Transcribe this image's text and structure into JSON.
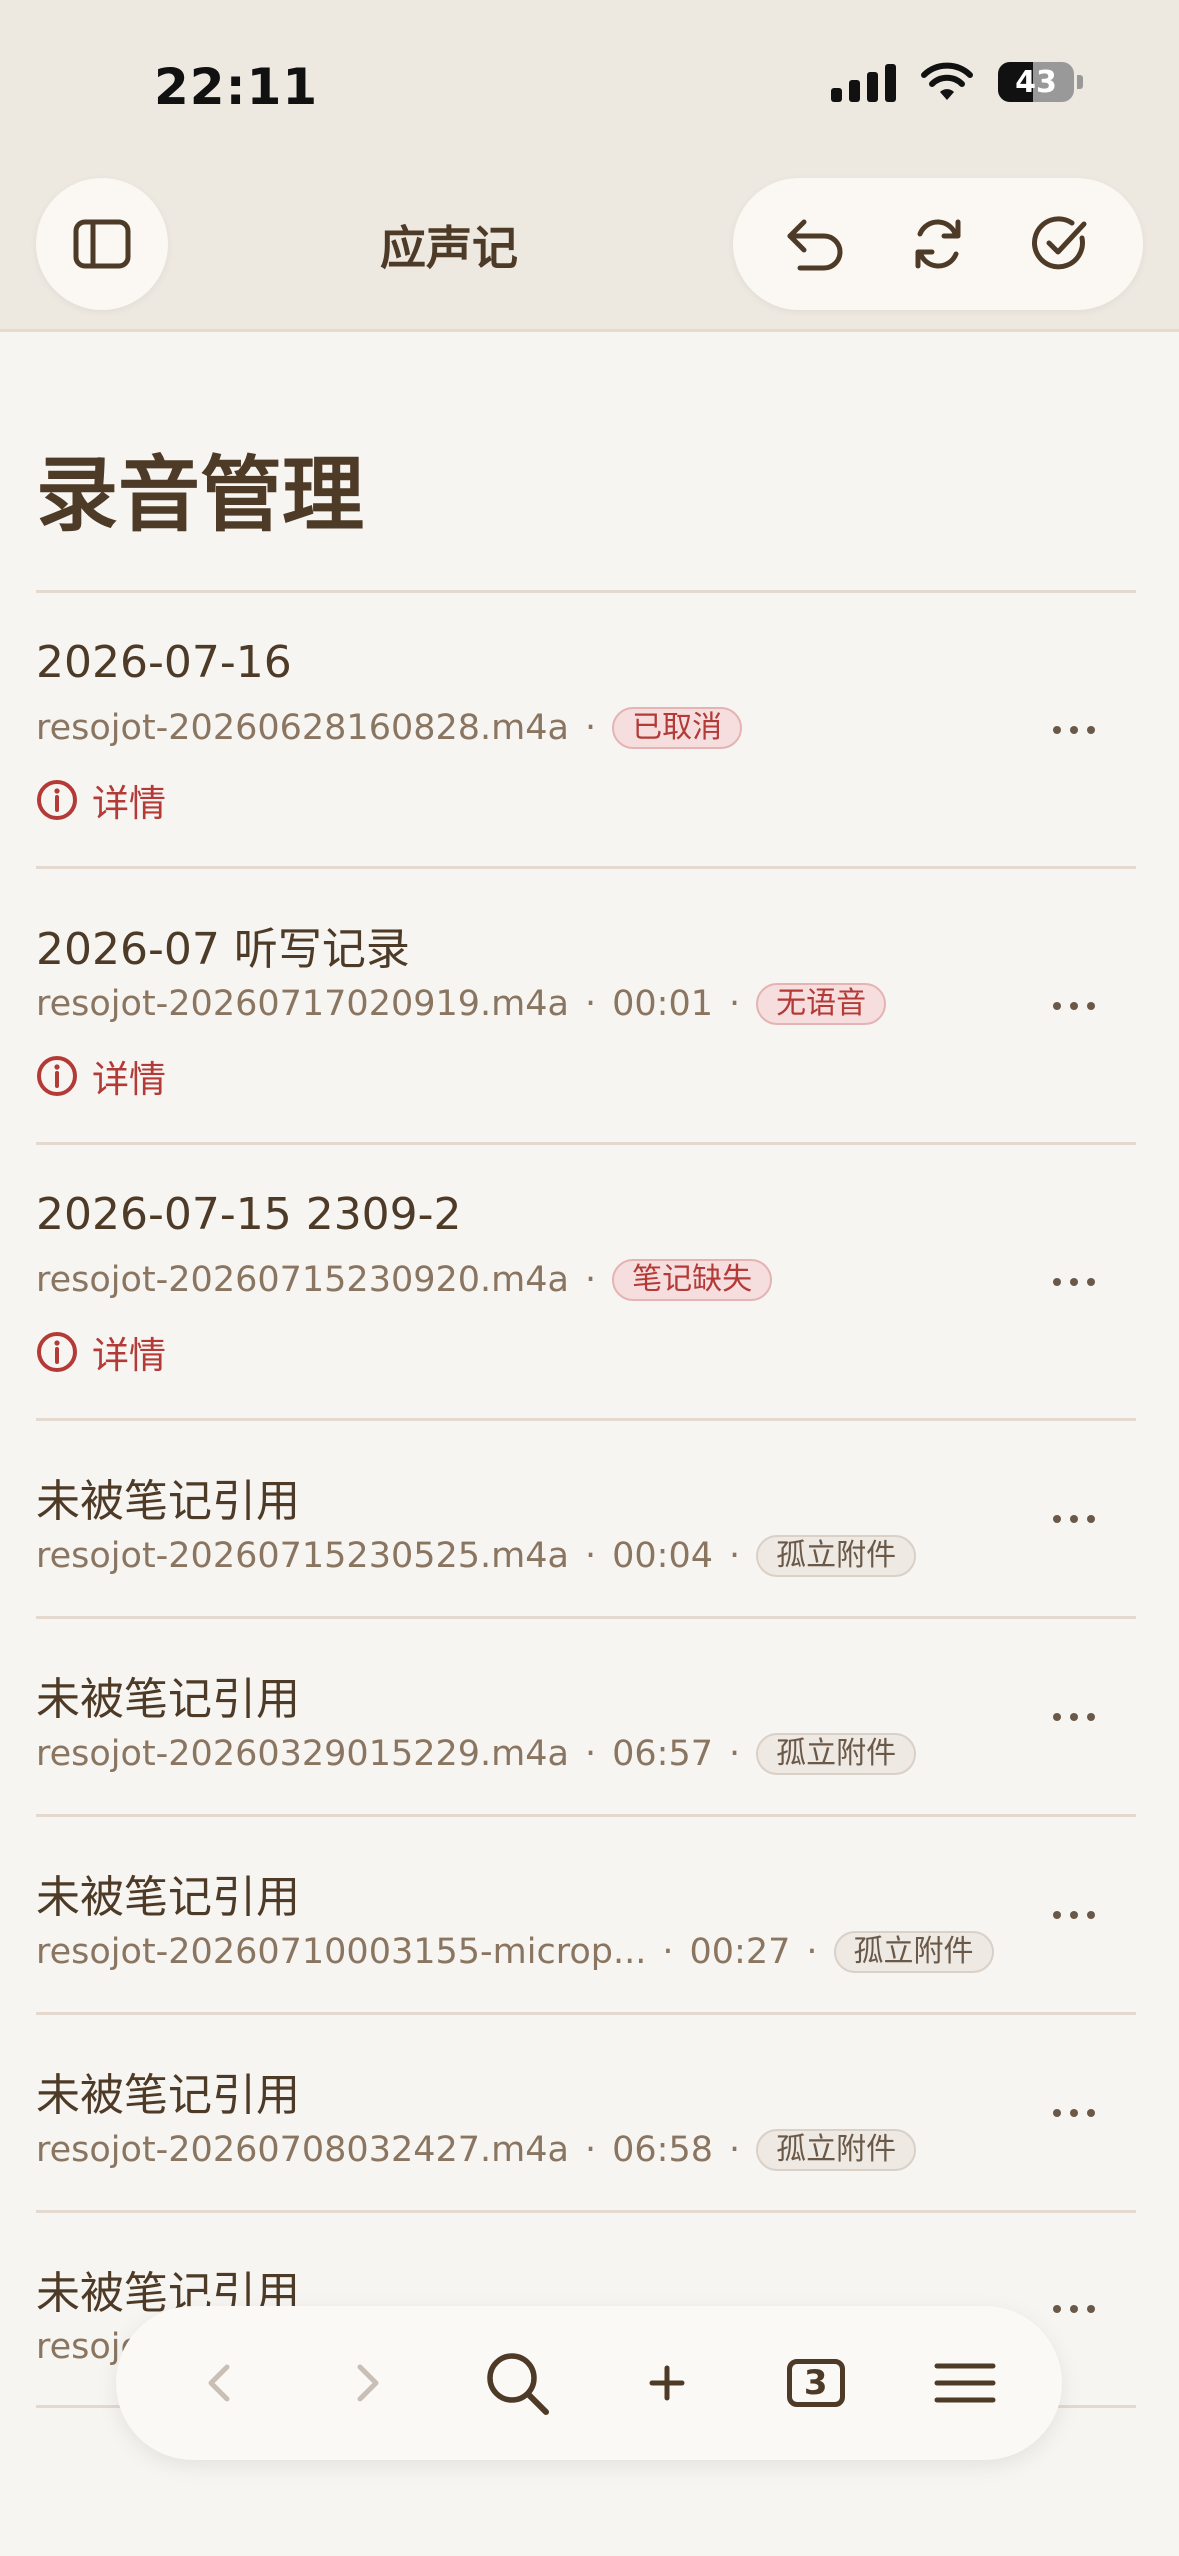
{
  "status_bar": {
    "time": "22:11",
    "battery": "43"
  },
  "header": {
    "title": "应声记"
  },
  "page": {
    "title": "录音管理"
  },
  "items": [
    {
      "title": "2026-07-16",
      "file": "resojot-20260628160828.m4a",
      "duration": "",
      "badge": "已取消",
      "badge_kind": "red",
      "detail": "详情"
    },
    {
      "title": "2026-07 听写记录",
      "file": "resojot-20260717020919.m4a",
      "duration": "00:01",
      "badge": "无语音",
      "badge_kind": "red",
      "detail": "详情"
    },
    {
      "title": "2026-07-15 2309-2",
      "file": "resojot-20260715230920.m4a",
      "duration": "",
      "badge": "笔记缺失",
      "badge_kind": "red",
      "detail": "详情"
    },
    {
      "title": "未被笔记引用",
      "file": "resojot-20260715230525.m4a",
      "duration": "00:04",
      "badge": "孤立附件",
      "badge_kind": "gray"
    },
    {
      "title": "未被笔记引用",
      "file": "resojot-20260329015229.m4a",
      "duration": "06:57",
      "badge": "孤立附件",
      "badge_kind": "gray"
    },
    {
      "title": "未被笔记引用",
      "file": "resojot-20260710003155-microp...",
      "duration": "00:27",
      "badge": "孤立附件",
      "badge_kind": "gray"
    },
    {
      "title": "未被笔记引用",
      "file": "resojot-20260708032427.m4a",
      "duration": "06:58",
      "badge": "孤立附件",
      "badge_kind": "gray"
    },
    {
      "title": "未被笔记引用",
      "file": "resojot-",
      "duration": "",
      "badge": "",
      "badge_kind": "gray"
    }
  ],
  "toolbar": {
    "tab_count": "3"
  },
  "colors": {
    "text": "#4d3a27",
    "red": "#b33a37",
    "background": "#f7f5f1"
  }
}
